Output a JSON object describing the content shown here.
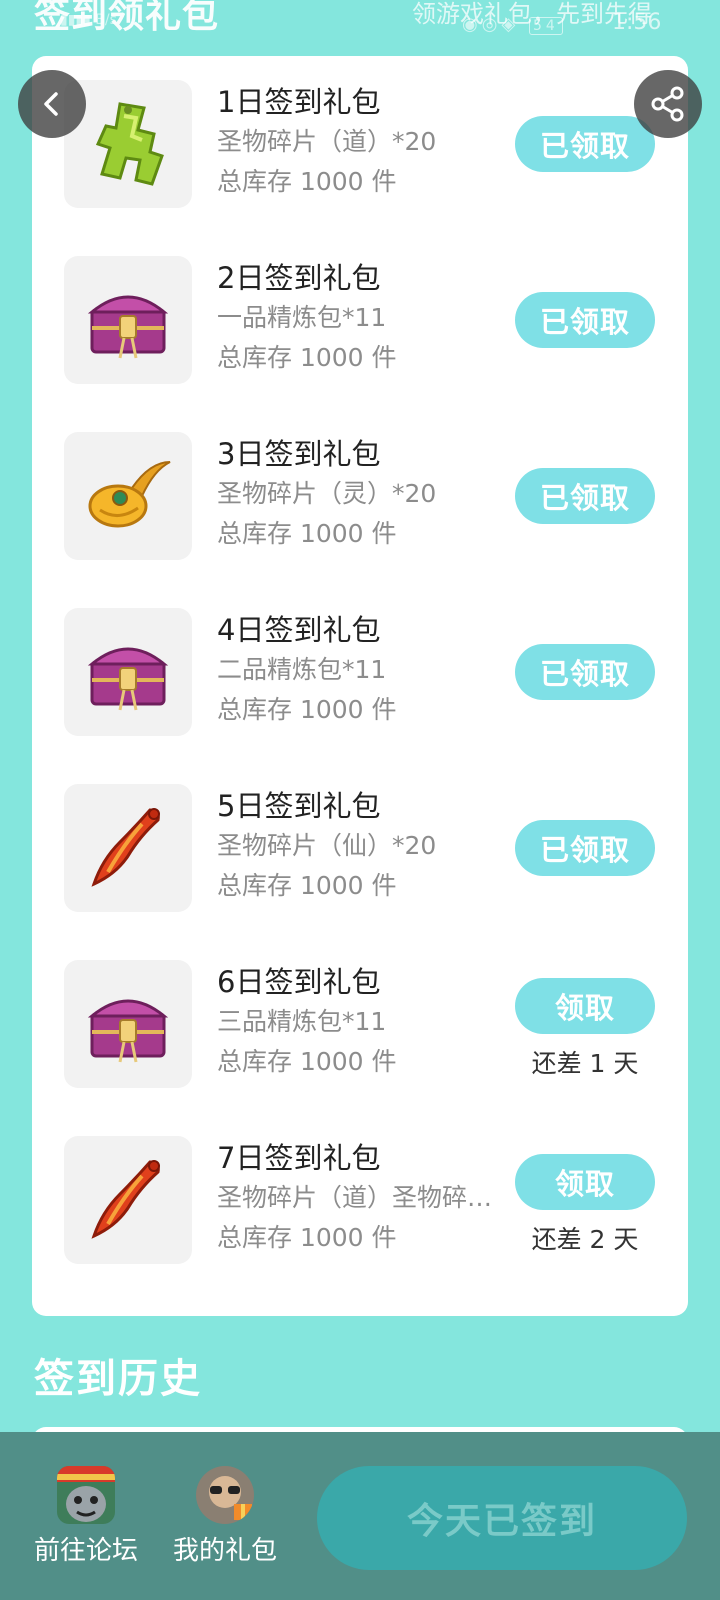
{
  "header": {
    "title": "签到领礼包",
    "subtitle": "领游戏礼包，先到先得",
    "status_net": "B/s",
    "status_battery": "54",
    "status_time": "1:56"
  },
  "gifts": [
    {
      "name": "1日签到礼包",
      "desc": "圣物碎片（道）*20",
      "stock": "总库存 1000 件",
      "button": "已领取",
      "remain": "",
      "icon": "green-relic-fragment-icon"
    },
    {
      "name": "2日签到礼包",
      "desc": "一品精炼包*11",
      "stock": "总库存 1000 件",
      "button": "已领取",
      "remain": "",
      "icon": "purple-chest-icon"
    },
    {
      "name": "3日签到礼包",
      "desc": "圣物碎片（灵）*20",
      "stock": "总库存 1000 件",
      "button": "已领取",
      "remain": "",
      "icon": "gold-relic-fragment-icon"
    },
    {
      "name": "4日签到礼包",
      "desc": "二品精炼包*11",
      "stock": "总库存 1000 件",
      "button": "已领取",
      "remain": "",
      "icon": "purple-chest-icon"
    },
    {
      "name": "5日签到礼包",
      "desc": "圣物碎片（仙）*20",
      "stock": "总库存 1000 件",
      "button": "已领取",
      "remain": "",
      "icon": "red-relic-fragment-icon"
    },
    {
      "name": "6日签到礼包",
      "desc": "三品精炼包*11",
      "stock": "总库存 1000 件",
      "button": "领取",
      "remain": "还差 1 天",
      "icon": "purple-chest-icon"
    },
    {
      "name": "7日签到礼包",
      "desc": "圣物碎片（道）圣物碎片（灵）",
      "stock": "总库存 1000 件",
      "button": "领取",
      "remain": "还差 2 天",
      "icon": "red-relic-fragment-icon"
    }
  ],
  "history": {
    "title": "签到历史"
  },
  "bottom": {
    "forum_label": "前往论坛",
    "gifts_label": "我的礼包",
    "signed_label": "今天已签到"
  },
  "colors": {
    "background": "#84E6DD",
    "button": "#7FE0E6",
    "bottom_bar": "#518F88",
    "signed_button": "#3AA8A9"
  }
}
